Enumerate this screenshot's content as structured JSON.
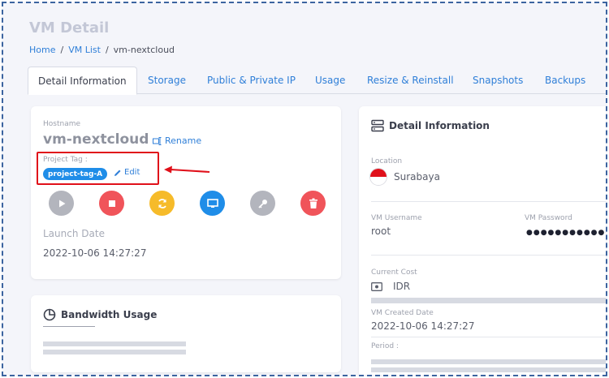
{
  "page": {
    "title": "VM Detail",
    "breadcrumb": {
      "home": "Home",
      "list": "VM List",
      "current": "vm-nextcloud",
      "separator": "/"
    }
  },
  "tabs": [
    {
      "label": "Detail Information",
      "active": true
    },
    {
      "label": "Storage"
    },
    {
      "label": "Public & Private IP"
    },
    {
      "label": "Usage"
    },
    {
      "label": "Resize & Reinstall"
    },
    {
      "label": "Snapshots"
    },
    {
      "label": "Backups"
    }
  ],
  "vm": {
    "hostname_label": "Hostname",
    "name": "vm-nextcloud",
    "rename_label": "Rename",
    "project_tag_label": "Project Tag :",
    "project_tag": "project-tag-A",
    "edit_label": "Edit",
    "launch_date_label": "Launch Date",
    "launch_date": "2022-10-06 14:27:27"
  },
  "actions": [
    {
      "name": "play-icon",
      "color": "#b3b5bd"
    },
    {
      "name": "stop-icon",
      "color": "#f0545a"
    },
    {
      "name": "refresh-icon",
      "color": "#f6bb2a"
    },
    {
      "name": "console-icon",
      "color": "#1f8de8"
    },
    {
      "name": "key-icon",
      "color": "#b3b5bd"
    },
    {
      "name": "trash-icon",
      "color": "#f0545a"
    }
  ],
  "bandwidth": {
    "title": "Bandwidth Usage"
  },
  "detail": {
    "title": "Detail Information",
    "location_label": "Location",
    "location": "Surabaya",
    "username_label": "VM Username",
    "username": "root",
    "password_label": "VM Password",
    "password": "●●●●●●●●●●●●",
    "cost_label": "Current Cost",
    "cost_currency": "IDR",
    "created_label": "VM Created Date",
    "created": "2022-10-06 14:27:27",
    "period_label": "Period :"
  },
  "colors": {
    "accent": "#2f7fd8",
    "highlight": "#e0101a"
  }
}
